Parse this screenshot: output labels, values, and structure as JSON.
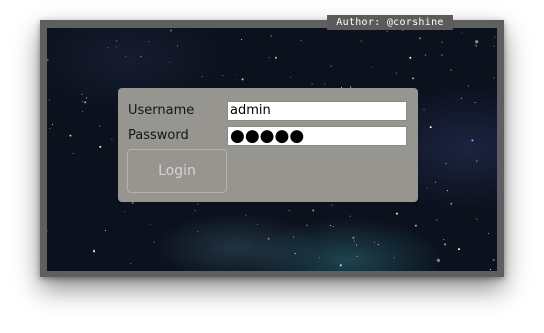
{
  "watermark": {
    "author": "Author: @corshine"
  },
  "login_form": {
    "username_label": "Username",
    "username_value": "admin",
    "password_label": "Password",
    "password_value": "●●●●●",
    "login_button_label": "Login"
  },
  "colors": {
    "frame": "#5f5f5f",
    "panel": "#979590",
    "wallpaper": "#0b111d",
    "button_text": "#d6d4cf"
  },
  "icons": {
    "background": "starfield-wallpaper"
  }
}
